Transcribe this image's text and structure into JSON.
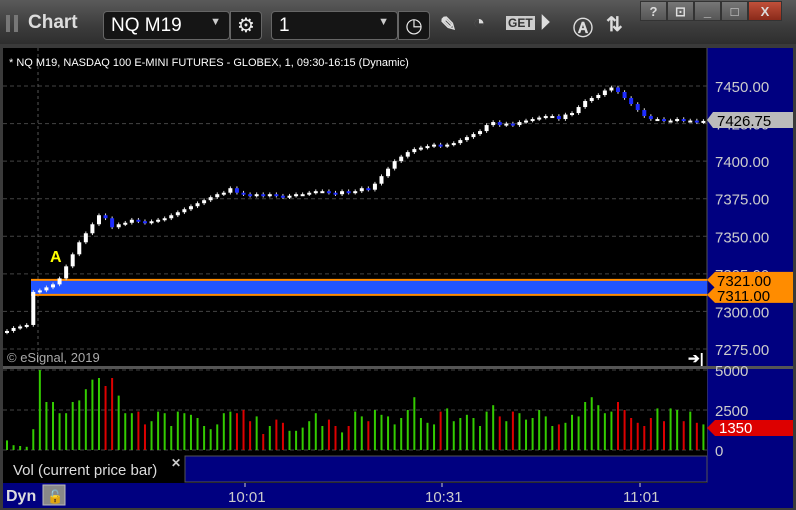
{
  "window": {
    "title": "Chart",
    "symbol": "NQ M19",
    "interval": "1",
    "help": "?",
    "close": "X"
  },
  "chart": {
    "header": "* NQ M19, NASDAQ 100 E-MINI FUTURES - GLOBEX, 1, 09:30-16:15 (Dynamic)",
    "copyright": "© eSignal, 2019",
    "marker": "A",
    "price_ticks": [
      "7450.00",
      "7425.00",
      "7400.00",
      "7375.00",
      "7350.00",
      "7325.00",
      "7300.00",
      "7275.00"
    ],
    "price_tick_values": [
      7450,
      7425,
      7400,
      7375,
      7350,
      7325,
      7300,
      7275
    ],
    "last_price": "7426.75",
    "level_high": "7321.00",
    "level_low": "7311.00",
    "colors": {
      "up_candle": "#ffffff",
      "down_candle": "#1e2cff",
      "band": "#2255ff",
      "level": "#ff8c00",
      "axis_bg": "#000080",
      "vol_up": "#33cc00",
      "vol_down": "#dd0000"
    },
    "closes": [
      7287,
      7289,
      7290,
      7291,
      7313,
      7314,
      7316,
      7318,
      7322,
      7330,
      7338,
      7346,
      7352,
      7358,
      7364,
      7362,
      7356,
      7358,
      7359,
      7361,
      7360,
      7359,
      7360,
      7361,
      7362,
      7364,
      7366,
      7368,
      7370,
      7372,
      7374,
      7376,
      7378,
      7379,
      7382,
      7379,
      7378,
      7377,
      7378,
      7377,
      7378,
      7377,
      7376,
      7377,
      7378,
      7378,
      7379,
      7380,
      7380,
      7379,
      7378,
      7380,
      7379,
      7380,
      7382,
      7381,
      7385,
      7390,
      7395,
      7400,
      7403,
      7406,
      7408,
      7409,
      7410,
      7411,
      7410,
      7411,
      7412,
      7414,
      7416,
      7418,
      7420,
      7424,
      7426,
      7424,
      7425,
      7424,
      7426,
      7427,
      7428,
      7429,
      7430,
      7430,
      7428,
      7431,
      7432,
      7436,
      7440,
      7442,
      7444,
      7447,
      7449,
      7446,
      7442,
      7438,
      7434,
      7430,
      7428,
      7428,
      7427,
      7427,
      7428,
      7427,
      7427,
      7426,
      7426.75
    ],
    "volume_ticks": [
      "5000",
      "2500",
      "0"
    ],
    "volumes": [
      600,
      300,
      250,
      200,
      1300,
      5000,
      3000,
      3000,
      2300,
      2300,
      3000,
      3100,
      3800,
      4400,
      4500,
      4000,
      4500,
      3400,
      2300,
      2300,
      2400,
      1600,
      1800,
      2400,
      2300,
      1500,
      2400,
      2300,
      2200,
      2000,
      1500,
      1300,
      1600,
      2300,
      2400,
      2300,
      2500,
      1800,
      2100,
      1000,
      1500,
      1900,
      1700,
      1200,
      1200,
      1400,
      1800,
      2300,
      1500,
      1900,
      1500,
      1100,
      1500,
      2400,
      2100,
      1800,
      2500,
      2200,
      2100,
      1600,
      2000,
      2500,
      3300,
      2000,
      1700,
      1600,
      2400,
      2600,
      1800,
      2000,
      2200,
      2000,
      1500,
      2400,
      2800,
      2100,
      1800,
      2400,
      2300,
      1900,
      2000,
      2500,
      2100,
      1500,
      1600,
      1700,
      2200,
      2100,
      3000,
      3300,
      2800,
      2300,
      2400,
      3000,
      2500,
      2000,
      1700,
      1500,
      2000,
      2600,
      1800,
      2600,
      2500,
      1800,
      2400,
      1700,
      1600,
      1350
    ],
    "current_volume": "1350",
    "volume_study": "Vol (current price bar)",
    "time_ticks": [
      "10:01",
      "10:31",
      "11:01"
    ],
    "mode": "Dyn"
  }
}
